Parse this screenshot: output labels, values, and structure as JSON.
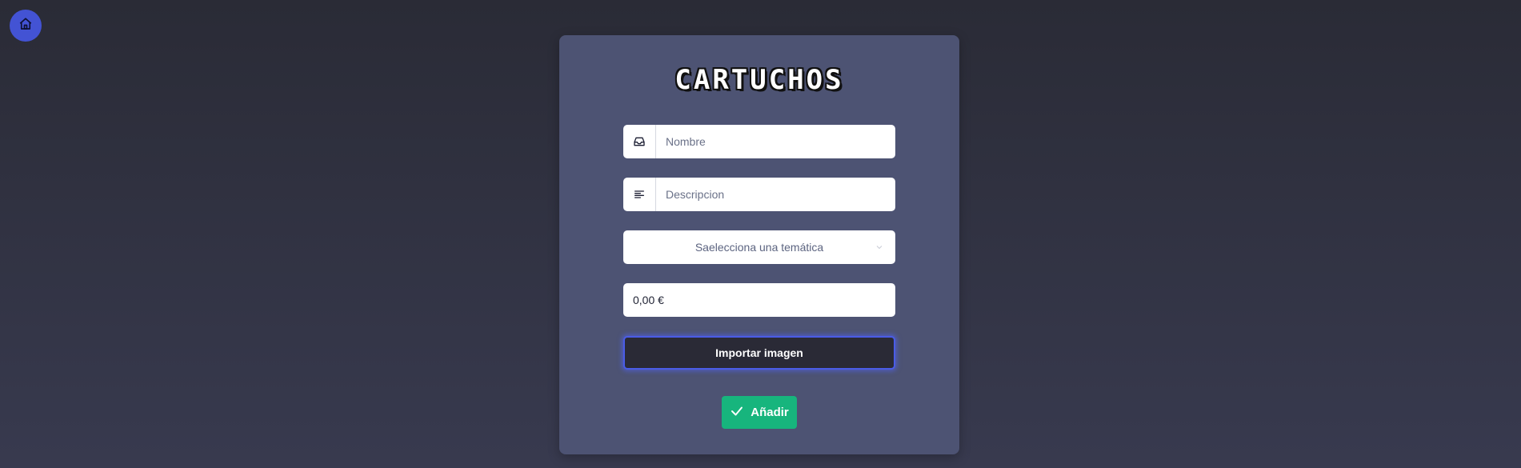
{
  "nav": {
    "home_icon": "home-icon"
  },
  "card": {
    "logo_text": "CARTUCHOS",
    "fields": {
      "nombre": {
        "placeholder": "Nombre",
        "icon": "inbox-icon"
      },
      "descripcion": {
        "placeholder": "Descripcion",
        "icon": "align-left-icon"
      },
      "tematica": {
        "selected": "Saelecciona una temática",
        "icon": "chevron-down-icon"
      },
      "precio": {
        "value": "0,00 €"
      }
    },
    "import_label": "Importar imagen",
    "add_label": "Añadir",
    "add_icon": "check-icon"
  },
  "colors": {
    "background": "#2e2f3b",
    "card": "#4d5373",
    "home_button": "#4353d4",
    "import_button": "#2a2a36",
    "import_border": "#4a5ce6",
    "add_button": "#17b57d"
  }
}
